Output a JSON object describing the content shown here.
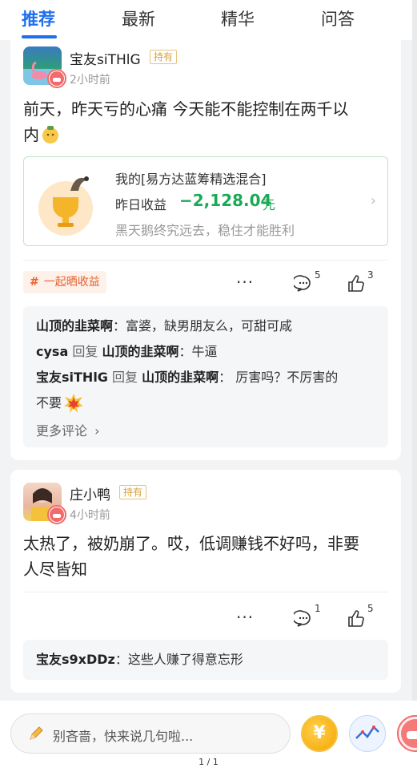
{
  "tabs": [
    {
      "label": "推荐",
      "active": true
    },
    {
      "label": "最新",
      "active": false
    },
    {
      "label": "精华",
      "active": false
    },
    {
      "label": "问答",
      "active": false
    }
  ],
  "posts": [
    {
      "username": "宝友siTHlG",
      "hold_tag": "持有",
      "time": "2小时前",
      "text_line1": "前天，昨天亏的心痛 今天能不能控制在两千以",
      "text_line2": "内",
      "fund": {
        "title": "我的[易方达蓝筹精选混合]",
        "label": "昨日收益",
        "value": "−2,128.04",
        "unit": "元",
        "slogan": "黑天鹅终究远去，稳住才能胜利"
      },
      "topic_tag": "一起晒收益",
      "comment_count": "5",
      "like_count": "3",
      "comments": [
        {
          "author": "山顶的韭菜啊",
          "reply": "",
          "target": "",
          "text": "：富婆，缺男朋友么，可甜可咸"
        },
        {
          "author": "cysa",
          "reply": "回复",
          "target": "山顶的韭菜啊",
          "text": "：牛逼"
        },
        {
          "author": "宝友siTHlG",
          "reply": "回复",
          "target": "山顶的韭菜啊",
          "text": "： 厉害吗？不厉害的"
        },
        {
          "author": "",
          "reply": "",
          "target": "",
          "text": "不要"
        }
      ],
      "more_comments": "更多评论"
    },
    {
      "username": "庄小鸭",
      "hold_tag": "持有",
      "time": "4小时前",
      "text_line1": "太热了，被奶崩了。哎，低调赚钱不好吗，非要",
      "text_line2": "人尽皆知",
      "comment_count": "1",
      "like_count": "5",
      "comments": [
        {
          "author": "宝友s9xDDz",
          "text": "：这些人赚了得意忘形"
        }
      ]
    }
  ],
  "bottom_bar": {
    "placeholder": "别吝啬，快来说几句啦...",
    "coin_symbol": "¥"
  },
  "page_indicator": "1 / 1",
  "colors": {
    "accent": "#1e6ef0",
    "loss_green": "#1aaa55",
    "topic_orange": "#e8612c",
    "hold_gold": "#d9a13b"
  }
}
